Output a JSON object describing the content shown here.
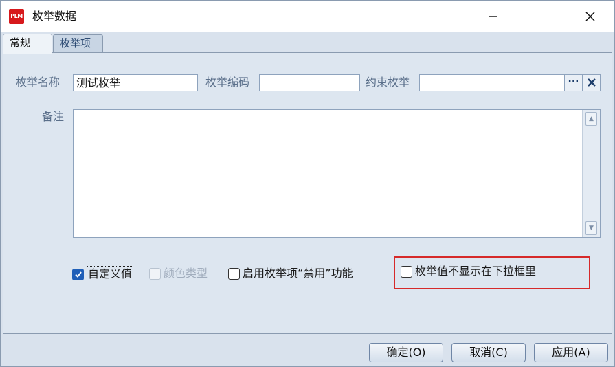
{
  "window": {
    "logo_text": "PLM",
    "title": "枚举数据"
  },
  "tabs": [
    {
      "label": "常规"
    },
    {
      "label": "枚举项"
    }
  ],
  "form": {
    "enum_name_label": "枚举名称",
    "enum_name_value": "测试枚举",
    "enum_code_label": "枚举编码",
    "enum_code_value": "",
    "constraint_label": "约束枚举",
    "constraint_value": "",
    "browse_glyph": "···",
    "clear_glyph": "✕",
    "remark_label": "备注",
    "remark_value": ""
  },
  "options": {
    "custom_value": {
      "label": "自定义值",
      "checked": true
    },
    "color_type": {
      "label": "颜色类型",
      "checked": false,
      "disabled": true
    },
    "enable_disable_fn": {
      "label": "启用枚举项“禁用”功能",
      "checked": false
    },
    "hide_in_dropdown": {
      "label": "枚举值不显示在下拉框里",
      "checked": false
    }
  },
  "buttons": {
    "ok": "确定(O)",
    "cancel": "取消(C)",
    "apply": "应用(A)"
  },
  "colors": {
    "accent": "#1f5fb8",
    "highlight_border": "#d62a2a",
    "logo_bg": "#d7191c"
  }
}
